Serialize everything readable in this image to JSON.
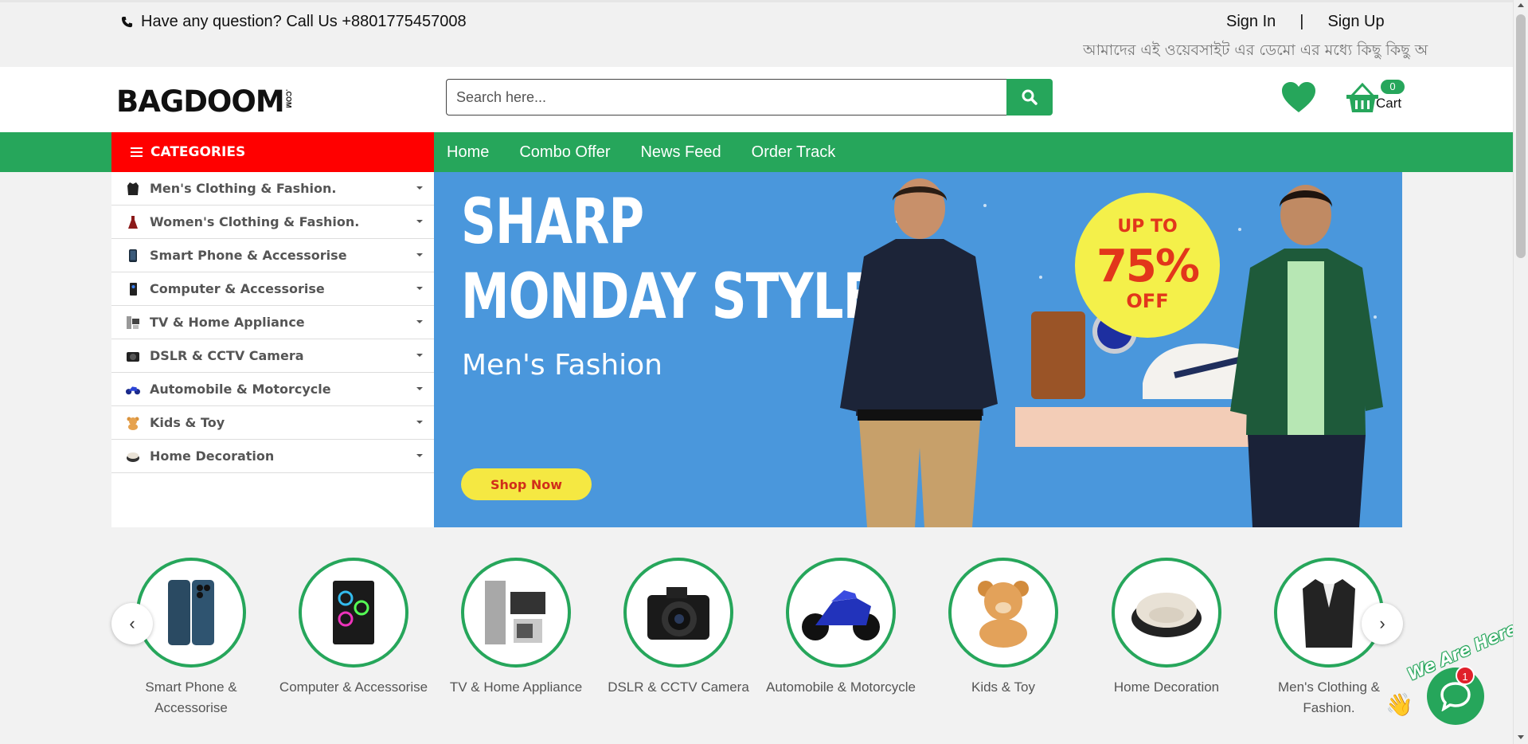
{
  "topbar": {
    "phone_text": "Have any question? Call Us +8801775457008",
    "sign_in": "Sign In",
    "divider": "|",
    "sign_up": "Sign Up",
    "marquee": "আমাদের এই ওয়েবসাইট এর ডেমো এর মধ্যে কিছু কিছু অ"
  },
  "header": {
    "logo_main": "BAGDOOM",
    "logo_suffix": ".COM",
    "search_placeholder": "Search here...",
    "cart_count": "0",
    "cart_label": "Cart"
  },
  "nav": {
    "categories_label": "CATEGORIES",
    "links": [
      "Home",
      "Combo Offer",
      "News Feed",
      "Order Track"
    ]
  },
  "sidebar": {
    "items": [
      {
        "label": "Men's Clothing & Fashion.",
        "icon": "jacket-icon"
      },
      {
        "label": "Women's Clothing & Fashion.",
        "icon": "dress-icon"
      },
      {
        "label": "Smart Phone & Accessorise",
        "icon": "phone-icon"
      },
      {
        "label": "Computer & Accessorise",
        "icon": "pc-tower-icon"
      },
      {
        "label": "TV & Home Appliance",
        "icon": "appliance-icon"
      },
      {
        "label": "DSLR & CCTV Camera",
        "icon": "camera-icon"
      },
      {
        "label": "Automobile & Motorcycle",
        "icon": "motorcycle-icon"
      },
      {
        "label": "Kids & Toy",
        "icon": "teddy-bear-icon"
      },
      {
        "label": "Home Decoration",
        "icon": "chair-icon"
      }
    ]
  },
  "banner": {
    "line1": "SHARP",
    "line2": "MONDAY STYLE",
    "subtitle": "Men's Fashion",
    "cta": "Shop Now",
    "badge_top": "UP TO",
    "badge_pct": "75%",
    "badge_bottom": "OFF"
  },
  "carousel": {
    "prev": "‹",
    "next": "›",
    "items": [
      {
        "line1": "Smart Phone &",
        "line2": "Accessorise"
      },
      {
        "line1": "Computer & Accessorise",
        "line2": ""
      },
      {
        "line1": "TV & Home Appliance",
        "line2": ""
      },
      {
        "line1": "DSLR & CCTV Camera",
        "line2": ""
      },
      {
        "line1": "Automobile & Motorcycle",
        "line2": ""
      },
      {
        "line1": "Kids & Toy",
        "line2": ""
      },
      {
        "line1": "Home Decoration",
        "line2": ""
      },
      {
        "line1": "Men's Clothing &",
        "line2": "Fashion."
      }
    ]
  },
  "chat": {
    "text": "We Are Here!",
    "badge": "1"
  },
  "colors": {
    "brand_green": "#26a65b",
    "categories_red": "#ff0000",
    "banner_blue": "#4a97dc",
    "badge_yellow": "#f4f04a"
  }
}
